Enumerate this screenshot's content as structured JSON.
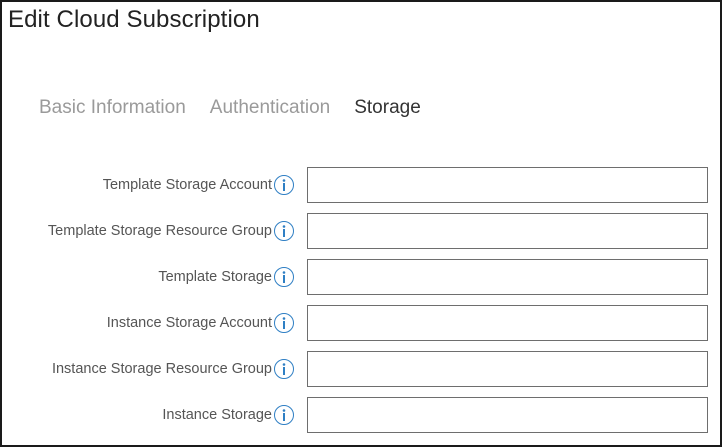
{
  "window": {
    "title": "Edit Cloud Subscription"
  },
  "tabs": [
    {
      "label": "Basic Information",
      "active": false
    },
    {
      "label": "Authentication",
      "active": false
    },
    {
      "label": "Storage",
      "active": true
    }
  ],
  "form": {
    "fields": [
      {
        "label": "Template Storage Account",
        "value": "",
        "icon": "info-icon"
      },
      {
        "label": "Template Storage Resource Group",
        "value": "",
        "icon": "info-icon"
      },
      {
        "label": "Template Storage",
        "value": "",
        "icon": "info-icon"
      },
      {
        "label": "Instance Storage Account",
        "value": "",
        "icon": "info-icon"
      },
      {
        "label": "Instance Storage Resource Group",
        "value": "",
        "icon": "info-icon"
      },
      {
        "label": "Instance Storage",
        "value": "",
        "icon": "info-icon"
      }
    ]
  },
  "colors": {
    "accent": "#2f7fc4",
    "inactive_tab": "#9a9a9a",
    "active_tab": "#333333",
    "border": "#1a1a1a"
  }
}
